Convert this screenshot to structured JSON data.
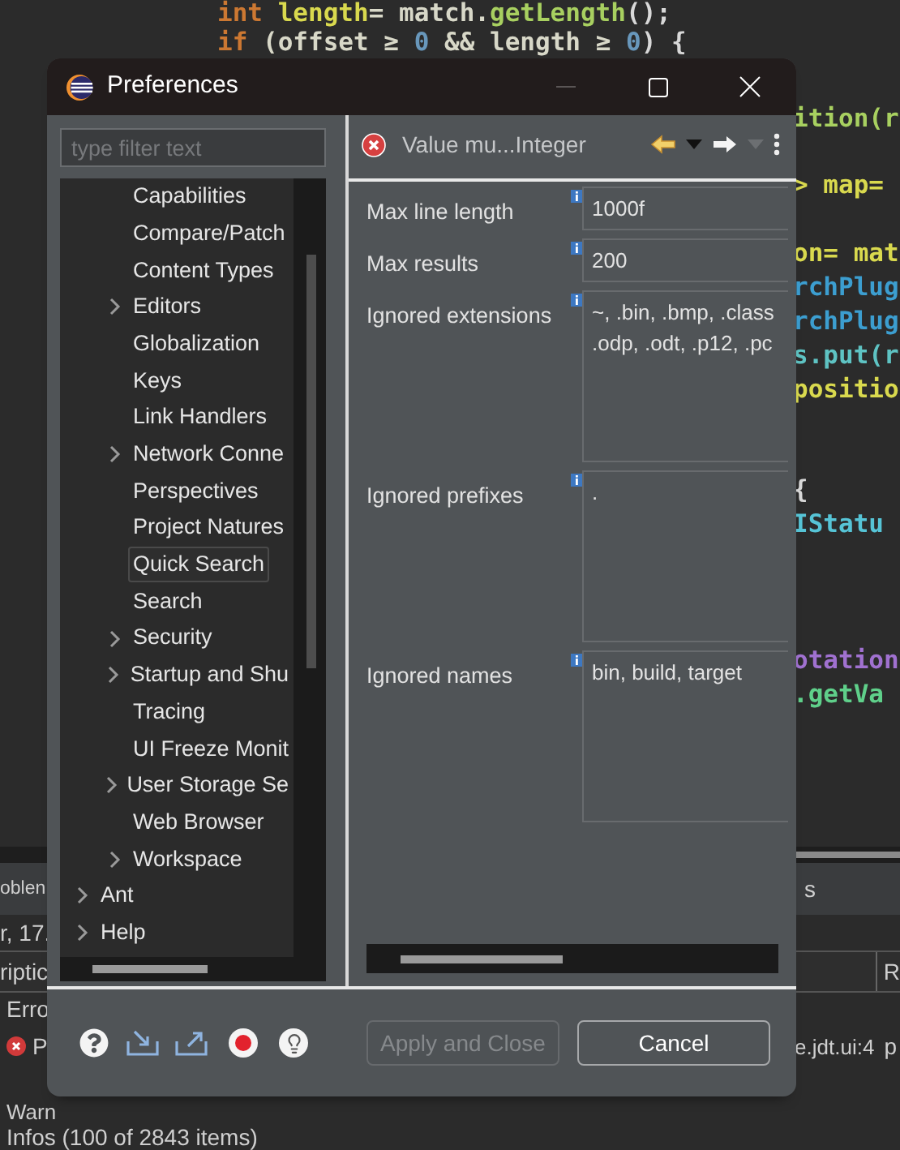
{
  "editor": {
    "lines": [
      {
        "tokens": [
          {
            "text": "int ",
            "color": "#cc7832"
          },
          {
            "text": "length",
            "color": "#d9d94e"
          },
          {
            "text": "= match.",
            "color": "#d8d8c8"
          },
          {
            "text": "getLength",
            "color": "#a8d060"
          },
          {
            "text": "();",
            "color": "#d8d8d8"
          }
        ]
      },
      {
        "tokens": [
          {
            "text": "if",
            "color": "#cc7832"
          },
          {
            "text": " (offset ≥ ",
            "color": "#d8d8c8"
          },
          {
            "text": "0",
            "color": "#6897bb"
          },
          {
            "text": " && length ≥ ",
            "color": "#d8d8c8"
          },
          {
            "text": "0",
            "color": "#6897bb"
          },
          {
            "text": ") {",
            "color": "#d8d8d8"
          }
        ]
      }
    ],
    "fragments": [
      {
        "text": "ition(r",
        "color": "#a8d060"
      },
      {
        "text": "> map=",
        "color": "#d9d94e"
      },
      {
        "text": "on= mat",
        "color": "#d9d94e"
      },
      {
        "text": "rchPlug",
        "color": "#3c9ed0"
      },
      {
        "text": "rchPlug",
        "color": "#3c9ed0"
      },
      {
        "text": "s.put(r",
        "color": "#5ec3c3"
      },
      {
        "text": "positio",
        "color": "#d9d94e"
      },
      {
        "text": "{",
        "color": "#d8d8d8"
      },
      {
        "text": "IStatu",
        "color": "#56c4d6"
      },
      {
        "text": "otation",
        "color": "#a071d0"
      },
      {
        "text": ".getVa",
        "color": "#5fd08a"
      }
    ]
  },
  "problems": {
    "tab": "oblen",
    "tab_2": "s",
    "summary": "r, 17.",
    "columns": [
      "riptic",
      "R"
    ],
    "rows": [
      {
        "kind": "group",
        "label": "Erro"
      },
      {
        "kind": "error",
        "label": "P",
        "column_3": "e.jdt.ui:4",
        "column_4": "p"
      },
      {
        "kind": "group",
        "label": "Warn"
      },
      {
        "kind": "group",
        "label": "Infos (100 of 2843 items)"
      }
    ]
  },
  "dialog": {
    "title": "Preferences",
    "filter": {
      "placeholder": "type filter text"
    },
    "tree": {
      "items": [
        {
          "children": [
            {
              "label": "Capabilities",
              "expandable": false,
              "selected": false
            },
            {
              "label": "Compare/Patch",
              "expandable": false,
              "selected": false
            },
            {
              "label": "Content Types",
              "expandable": false,
              "selected": false
            },
            {
              "label": "Editors",
              "expandable": true,
              "selected": false
            },
            {
              "label": "Globalization",
              "expandable": false,
              "selected": false
            },
            {
              "label": "Keys",
              "expandable": false,
              "selected": false
            },
            {
              "label": "Link Handlers",
              "expandable": false,
              "selected": false
            },
            {
              "label": "Network Conne",
              "expandable": true,
              "selected": false
            },
            {
              "label": "Perspectives",
              "expandable": false,
              "selected": false
            },
            {
              "label": "Project Natures",
              "expandable": false,
              "selected": false
            },
            {
              "label": "Quick Search",
              "expandable": false,
              "selected": true
            },
            {
              "label": "Search",
              "expandable": false,
              "selected": false
            },
            {
              "label": "Security",
              "expandable": true,
              "selected": false
            },
            {
              "label": "Startup and Shu",
              "expandable": true,
              "selected": false
            },
            {
              "label": "Tracing",
              "expandable": false,
              "selected": false
            },
            {
              "label": "UI Freeze Monit",
              "expandable": false,
              "selected": false
            },
            {
              "label": "User Storage Se",
              "expandable": true,
              "selected": false
            },
            {
              "label": "Web Browser",
              "expandable": false,
              "selected": false
            },
            {
              "label": "Workspace",
              "expandable": true,
              "selected": false
            }
          ]
        },
        {
          "label": "Ant",
          "expandable": true,
          "selected": false
        },
        {
          "label": "Help",
          "expandable": true,
          "selected": false
        }
      ]
    },
    "page": {
      "message": "Value mu...Integer",
      "fields": [
        {
          "kind": "line",
          "label": "Max line length",
          "lines": [
            "1000f"
          ]
        },
        {
          "kind": "line",
          "label": "Max results",
          "lines": [
            "200"
          ]
        },
        {
          "kind": "area",
          "label": "Ignored extensions",
          "lines": [
            "~, .bin, .bmp, .class",
            ".odp, .odt, .p12, .pc"
          ]
        },
        {
          "kind": "area",
          "label": "Ignored prefixes",
          "lines": [
            "."
          ]
        },
        {
          "kind": "area",
          "label": "Ignored names",
          "lines": [
            "bin, build, target"
          ]
        }
      ]
    },
    "buttons": [
      {
        "label": "Apply and Close",
        "disabled": true
      },
      {
        "label": "Cancel",
        "disabled": false
      }
    ]
  }
}
